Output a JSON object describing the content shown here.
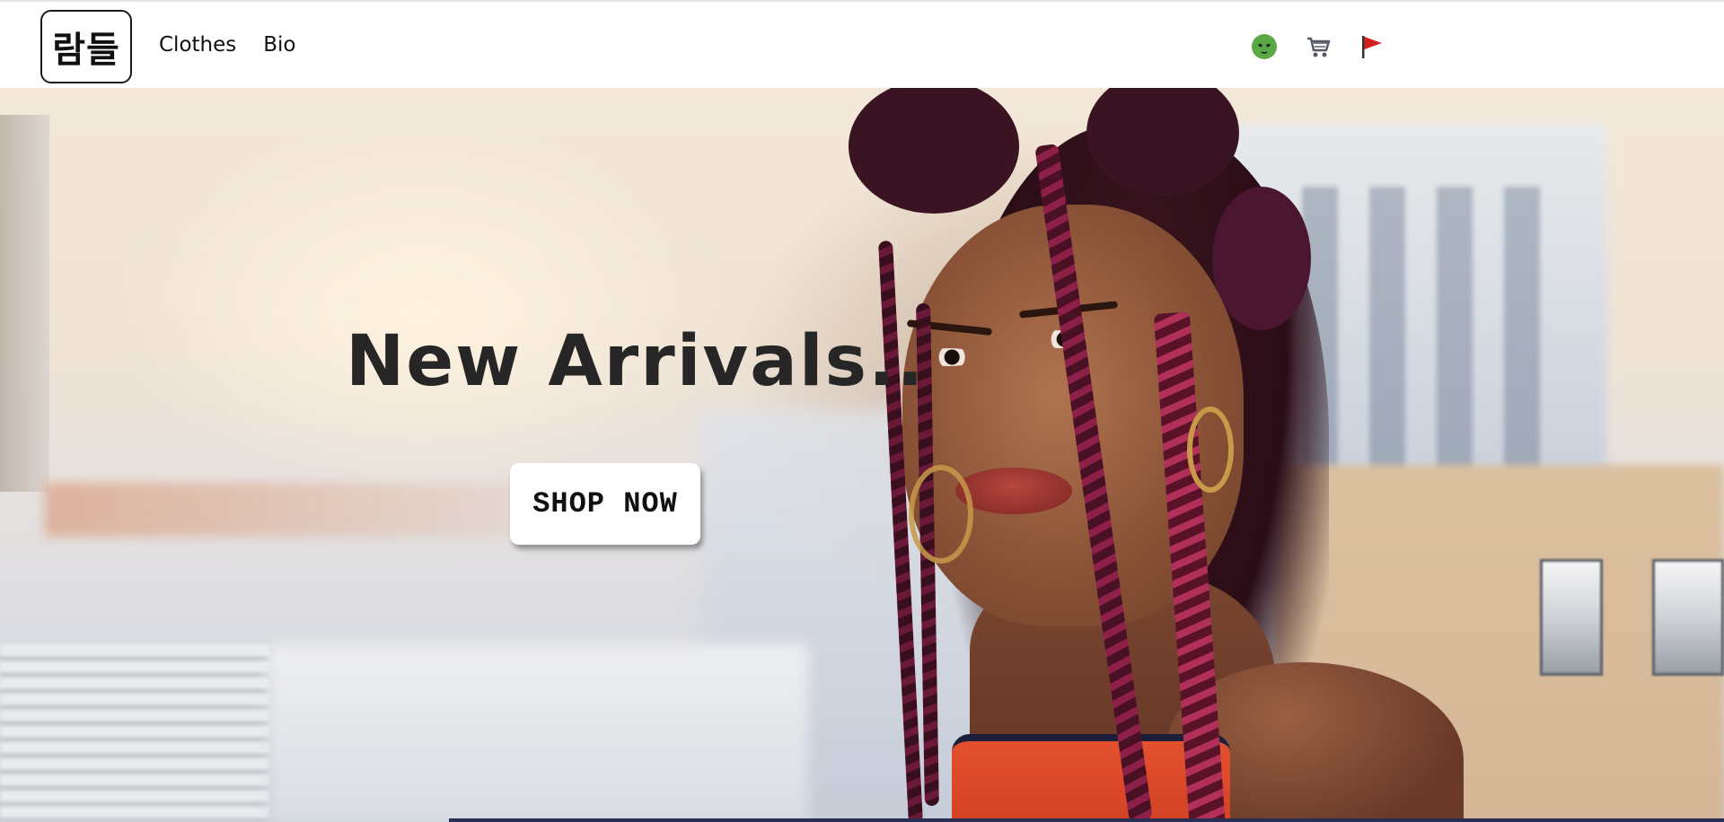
{
  "header": {
    "logo_text": "람들",
    "nav_links": [
      {
        "label": "Clothes"
      },
      {
        "label": "Bio"
      }
    ],
    "icons": [
      {
        "name": "alien-icon",
        "color": "#5aa844"
      },
      {
        "name": "cart-icon",
        "color": "#555a63"
      },
      {
        "name": "flag-icon",
        "color": "#d61f1f"
      }
    ]
  },
  "hero": {
    "title": "New Arrivals..",
    "cta_label": "SHOP NOW"
  }
}
